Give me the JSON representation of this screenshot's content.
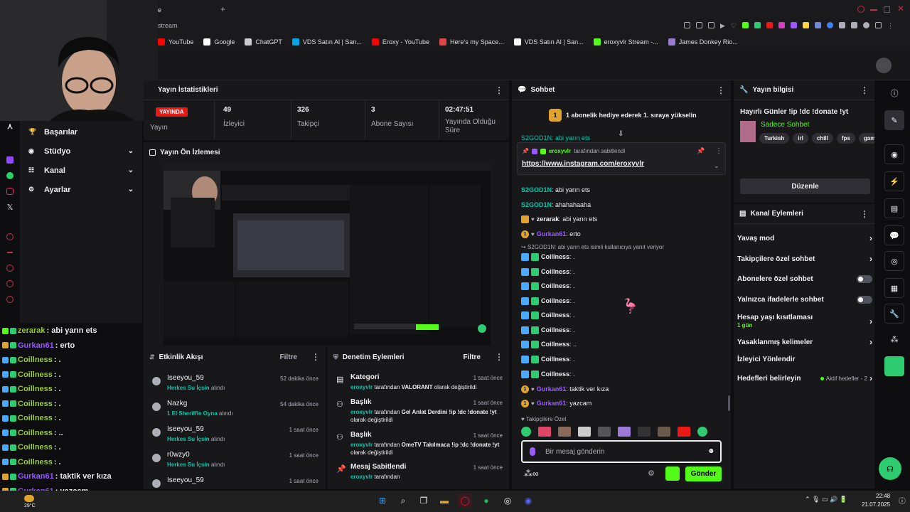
{
  "browser": {
    "tab_title": "e",
    "address_text": "stream",
    "bookmarks": [
      {
        "label": "YouTube",
        "icon": "youtube-icon",
        "color": "#ff0000"
      },
      {
        "label": "Google",
        "icon": "google-icon",
        "color": "#ffffff"
      },
      {
        "label": "ChatGPT",
        "icon": "chatgpt-icon",
        "color": "#cccccc"
      },
      {
        "label": "VDS Satın Al | San...",
        "icon": "k-icon",
        "color": "#00a8e8"
      },
      {
        "label": "Eroxy - YouTube",
        "icon": "youtube-icon",
        "color": "#ff0000"
      },
      {
        "label": "Here's my Space...",
        "icon": "space-icon",
        "color": "#e04646"
      },
      {
        "label": "VDS Satın Al | San...",
        "icon": "page-icon",
        "color": "#ffffff"
      },
      {
        "label": "eroxyvlr Stream -...",
        "icon": "kick-icon",
        "color": "#53fc18"
      },
      {
        "label": "James Donkey Rio...",
        "icon": "donkey-icon",
        "color": "#9b7bd6"
      }
    ]
  },
  "side_menu": {
    "items": [
      {
        "label": "Başarılar",
        "icon": "trophy-icon",
        "expandable": false
      },
      {
        "label": "Stüdyo",
        "icon": "studio-icon",
        "expandable": true
      },
      {
        "label": "Kanal",
        "icon": "channel-icon",
        "expandable": true
      },
      {
        "label": "Ayarlar",
        "icon": "gear-icon",
        "expandable": true
      }
    ]
  },
  "overlay_chat": [
    {
      "user": "zerarak",
      "text": ": abi yarın ets",
      "color": "#9acd32"
    },
    {
      "user": "Gurkan61",
      "text": ": erto",
      "color": "#9b59ff"
    },
    {
      "user": "Coillness",
      "text": ": .",
      "color": "#9acd32"
    },
    {
      "user": "Coillness",
      "text": ": .",
      "color": "#9acd32"
    },
    {
      "user": "Coillness",
      "text": ": .",
      "color": "#9acd32"
    },
    {
      "user": "Coillness",
      "text": ": .",
      "color": "#9acd32"
    },
    {
      "user": "Coillness",
      "text": ": .",
      "color": "#9acd32"
    },
    {
      "user": "Coillness",
      "text": ": ..",
      "color": "#9acd32"
    },
    {
      "user": "Coillness",
      "text": ": .",
      "color": "#9acd32"
    },
    {
      "user": "Coillness",
      "text": ": .",
      "color": "#9acd32"
    },
    {
      "user": "Gurkan61",
      "text": ": taktik ver kıza",
      "color": "#9b59ff"
    },
    {
      "user": "Gurkan61",
      "text": ": yazcam",
      "color": "#9b59ff"
    }
  ],
  "stats": {
    "title": "Yayın İstatistikleri",
    "live_label": "YAYINDA",
    "live_sub": "Yayın",
    "viewers": {
      "value": "49",
      "label": "İzleyici"
    },
    "followers": {
      "value": "326",
      "label": "Takipçi"
    },
    "subs": {
      "value": "3",
      "label": "Abone Sayısı"
    },
    "uptime": {
      "value": "02:47:51",
      "label": "Yayında Olduğu Süre"
    }
  },
  "preview": {
    "title": "Yayın Ön İzlemesi"
  },
  "activity": {
    "title": "Etkinlik Akışı",
    "filter": "Filtre",
    "items": [
      {
        "name": "Iseeyou_59",
        "desc_pre": "",
        "desc_bold": "Herkes Su İçsin",
        "desc_post": " alındı",
        "time": "52 dakika önce"
      },
      {
        "name": "Nazkg",
        "desc_pre": "",
        "desc_bold": "1 El Sheriffle Oyna",
        "desc_post": " alındı",
        "time": "54 dakika önce"
      },
      {
        "name": "Iseeyou_59",
        "desc_pre": "",
        "desc_bold": "Herkes Su İçsin",
        "desc_post": " alındı",
        "time": "1 saat önce"
      },
      {
        "name": "r0wzy0",
        "desc_pre": "",
        "desc_bold": "Herkes Su İçsin",
        "desc_post": " alındı",
        "time": "1 saat önce"
      },
      {
        "name": "Iseeyou_59",
        "desc_pre": "",
        "desc_bold": "",
        "desc_post": "",
        "time": "1 saat önce"
      }
    ]
  },
  "moderation": {
    "title": "Denetim Eylemleri",
    "filter": "Filtre",
    "items": [
      {
        "title": "Kategori",
        "by": "eroxyvlr",
        "mid": " tarafından ",
        "value": "VALORANT",
        "post": " olarak değiştirildi",
        "time": "1 saat önce",
        "icon": "category-icon"
      },
      {
        "title": "Başlık",
        "by": "eroxyvlr",
        "mid": " tarafından ",
        "value": "Gel Anlat Derdini !ip !dc !donate !yt",
        "post": " olarak değiştirildi",
        "time": "1 saat önce",
        "icon": "title-icon"
      },
      {
        "title": "Başlık",
        "by": "eroxyvlr",
        "mid": " tarafından ",
        "value": "OmeTV Takılmaca !ip !dc !donate !yt",
        "post": " olarak değiştirildi",
        "time": "1 saat önce",
        "icon": "title-icon"
      },
      {
        "title": "Mesaj Sabitlendi",
        "by": "eroxyvlr",
        "mid": " tarafından",
        "value": "",
        "post": "",
        "time": "1 saat önce",
        "icon": "pin-icon"
      }
    ]
  },
  "chat": {
    "title": "Sohbet",
    "gift_banner": "1 abonelik hediye ederek 1. sıraya yükselin",
    "gift_rank": "1",
    "partial_top": "S2GOD1N: abi yarın ets",
    "pinned_user": "eroxyvlr",
    "pinned_by": " tarafından sabitlendi",
    "pinned_link": "https://www.instagram.com/eroxyvlr",
    "messages": [
      {
        "user": "S2GOD1N",
        "text": ": abi yarın ets",
        "color": "#00c8af",
        "badge": "none"
      },
      {
        "user": "S2GOD1N",
        "text": ": ahahahaaha",
        "color": "#00c8af",
        "badge": "none"
      },
      {
        "user": "zerarak",
        "text": ": abi yarın ets",
        "color": "#efeff1",
        "badge": "crown"
      },
      {
        "user": "Gurkan61",
        "text": ": erto",
        "color": "#9b59ff",
        "badge": "sub"
      },
      {
        "user": "Coillness",
        "text": ": .",
        "color": "#efeff1",
        "badge": "emote"
      },
      {
        "user": "Coillness",
        "text": ": .",
        "color": "#efeff1",
        "badge": "emote"
      },
      {
        "user": "Coillness",
        "text": ": .",
        "color": "#efeff1",
        "badge": "emote"
      },
      {
        "user": "Coillness",
        "text": ": .",
        "color": "#efeff1",
        "badge": "emote"
      },
      {
        "user": "Coillness",
        "text": ": .",
        "color": "#efeff1",
        "badge": "emote"
      },
      {
        "user": "Coillness",
        "text": ": .",
        "color": "#efeff1",
        "badge": "emote"
      },
      {
        "user": "Coillness",
        "text": ": ..",
        "color": "#efeff1",
        "badge": "emote"
      },
      {
        "user": "Coillness",
        "text": ": .",
        "color": "#efeff1",
        "badge": "emote"
      },
      {
        "user": "Coillness",
        "text": ": .",
        "color": "#efeff1",
        "badge": "emote"
      },
      {
        "user": "Gurkan61",
        "text": ": taktik ver kıza",
        "color": "#9b59ff",
        "badge": "sub"
      },
      {
        "user": "Gurkan61",
        "text": ": yazcam",
        "color": "#9b59ff",
        "badge": "sub"
      }
    ],
    "reply_notice": "S2GOD1N: abi yarın ets isimli kullanıcıya yanıt veriyor",
    "followers_only": "Takipçilere Özel",
    "input_placeholder": "Bir mesaj gönderin",
    "send_label": "Gönder"
  },
  "stream_info": {
    "title": "Yayın bilgisi",
    "stream_title": "Hayırlı Günler !ip !dc !donate !yt",
    "category": "Sadece Sohbet",
    "tags": [
      "Turkish",
      "irl",
      "chill",
      "fps",
      "gamir"
    ],
    "edit_label": "Düzenle"
  },
  "channel_actions": {
    "title": "Kanal Eylemleri",
    "slow_mode": "Yavaş mod",
    "followers_chat": "Takipçilere özel sohbet",
    "subs_chat": "Abonelere özel sohbet",
    "emote_chat": "Yalnızca ifadelerle sohbet",
    "age_limit": "Hesap yaşı kısıtlaması",
    "age_limit_value": "1 gün",
    "banned_words": "Yasaklanmış kelimeler",
    "raid": "İzleyici Yönlendir",
    "goals": "Hedefleri belirleyin",
    "goals_status": "Aktif hedefler - 2"
  },
  "taskbar": {
    "weather": "29°C",
    "time": "22:48",
    "date": "21.07.2025"
  },
  "colors": {
    "accent": "#53fc18",
    "live": "#e91916",
    "link_green": "#00c8af",
    "purple": "#9b59ff"
  }
}
